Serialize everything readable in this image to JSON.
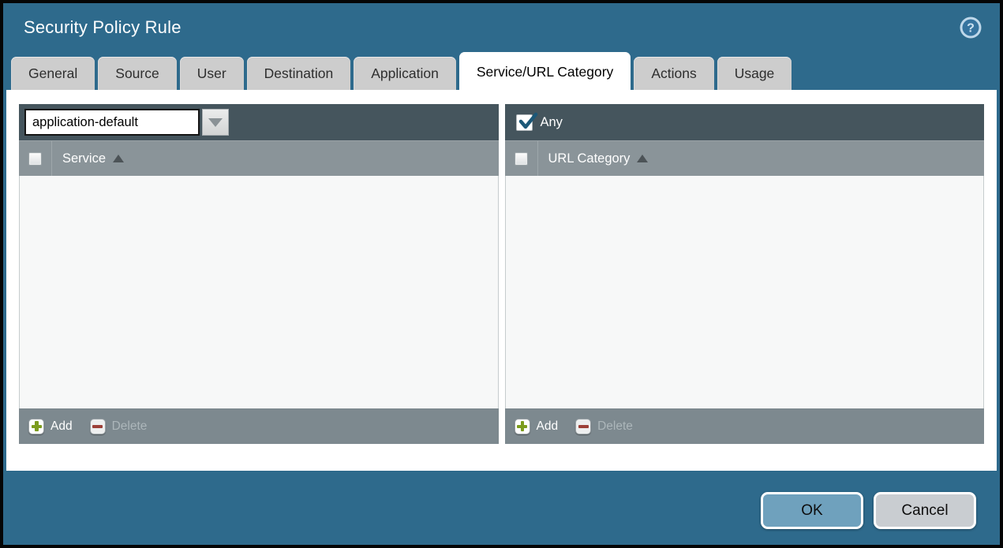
{
  "window": {
    "title": "Security Policy Rule"
  },
  "tabs": [
    {
      "label": "General",
      "active": false
    },
    {
      "label": "Source",
      "active": false
    },
    {
      "label": "User",
      "active": false
    },
    {
      "label": "Destination",
      "active": false
    },
    {
      "label": "Application",
      "active": false
    },
    {
      "label": "Service/URL Category",
      "active": true
    },
    {
      "label": "Actions",
      "active": false
    },
    {
      "label": "Usage",
      "active": false
    }
  ],
  "service_panel": {
    "dropdown": {
      "value": "application-default"
    },
    "columns": [
      {
        "label": "Service",
        "sort": "ascending"
      }
    ],
    "rows": [],
    "select_all_checked": false,
    "add_label": "Add",
    "delete_label": "Delete",
    "delete_enabled": false
  },
  "url_category_panel": {
    "any_checkbox": {
      "label": "Any",
      "checked": true
    },
    "columns": [
      {
        "label": "URL Category",
        "sort": "ascending"
      }
    ],
    "rows": [],
    "select_all_checked": false,
    "add_label": "Add",
    "delete_label": "Delete",
    "delete_enabled": false
  },
  "footer": {
    "ok_label": "OK",
    "cancel_label": "Cancel"
  },
  "icons": {
    "help": "question-mark-circle",
    "sort": "triangle-up",
    "dropdown": "triangle-down",
    "add": "green-plus",
    "delete": "red-minus"
  },
  "colors": {
    "titlebar_teal": "#2E6A8C",
    "panel_topbar": "#45555D",
    "panel_header": "#8A9499",
    "panel_footer": "#7D898F",
    "panel_body": "#F7F8F8",
    "tab_inactive": "#CDCDCD",
    "tab_active": "#FFFFFF",
    "ok_button": "#6FA1BD",
    "cancel_button": "#C9CDD1",
    "add_green": "#7C9C1E",
    "delete_red": "#9C4038",
    "check_mark": "#1C5878"
  }
}
